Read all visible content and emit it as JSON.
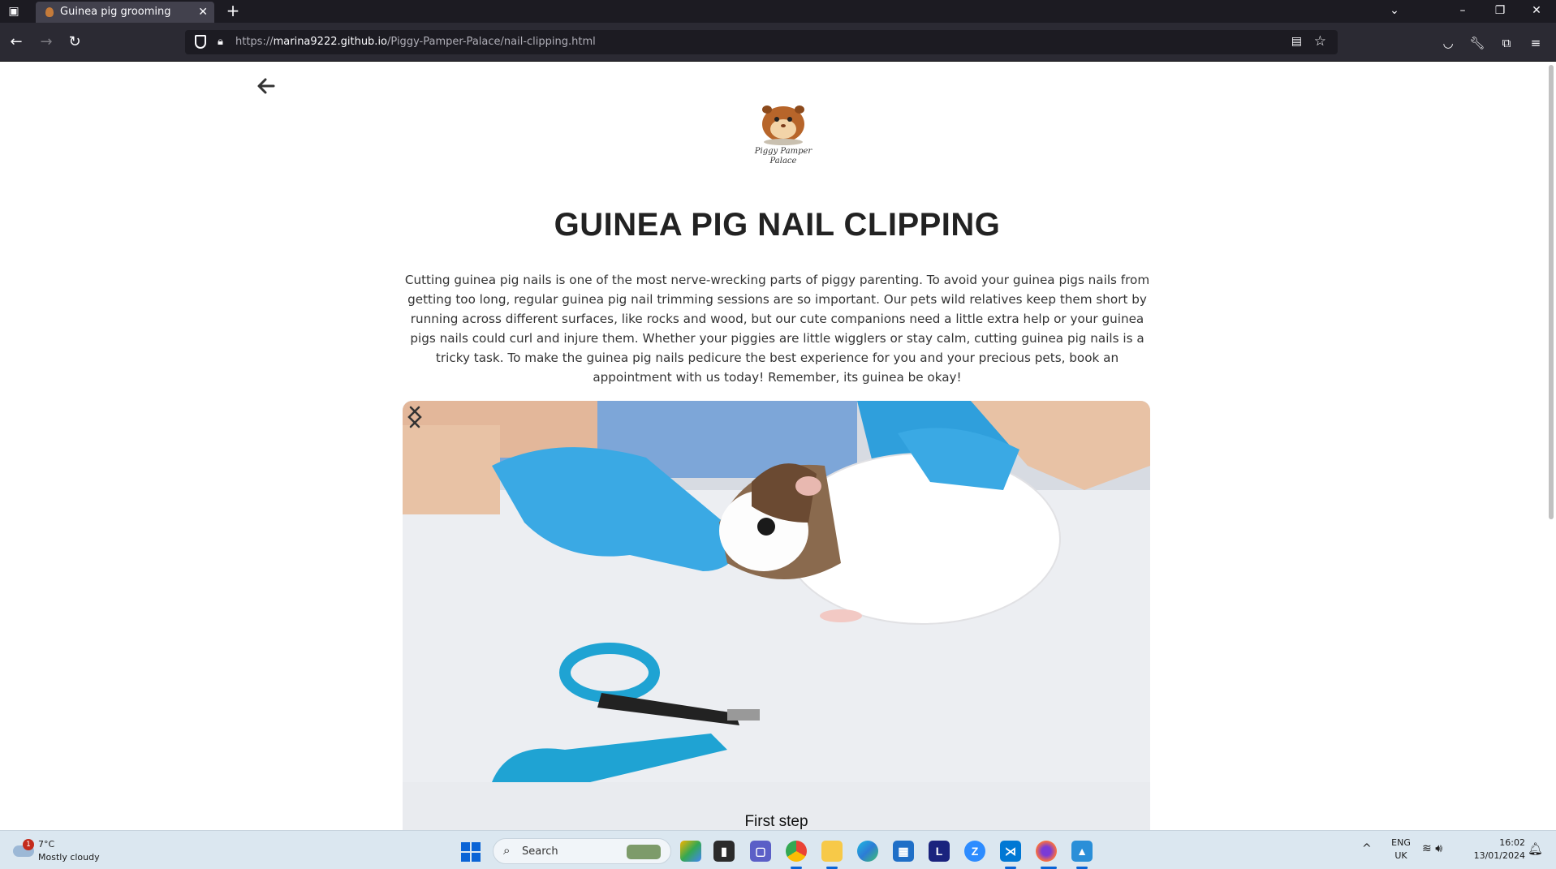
{
  "browser": {
    "tab_title": "Guinea pig grooming",
    "tab_close": "✕",
    "new_tab": "+",
    "url_prefix": "https://",
    "url_host": "marina9222.github.io",
    "url_path": "/Piggy-Pamper-Palace/nail-clipping.html"
  },
  "page": {
    "logo_text": "Piggy Pamper Palace",
    "title": "GUINEA PIG NAIL CLIPPING",
    "intro": "Cutting guinea pig nails is one of the most nerve-wrecking parts of piggy parenting. To avoid your guinea pigs nails from getting too long, regular guinea pig nail trimming sessions are so important. Our pets wild relatives keep them short by running across different surfaces, like rocks and wood, but our cute companions need a little extra help or your guinea pigs nails could curl and injure them. Whether your piggies are little wigglers or stay calm, cutting guinea pig nails is a tricky task. To make the guinea pig nails pedicure the best experience for you and your precious pets, book an appointment with us today! Remember, its guinea be okay!",
    "carousel": {
      "caption": "First step"
    }
  },
  "taskbar": {
    "weather_badge": "1",
    "weather_temp": "7°C",
    "weather_condition": "Mostly cloudy",
    "search_placeholder": "Search",
    "lang_line1": "ENG",
    "lang_line2": "UK",
    "time": "16:02",
    "date": "13/01/2024",
    "apps": [
      "copilot-icon",
      "terminal-icon",
      "teams-icon",
      "chrome-icon",
      "file-explorer-icon",
      "edge-icon",
      "store-icon",
      "l-app-icon",
      "zoom-icon",
      "vscode-icon",
      "firefox-icon",
      "photos-icon"
    ]
  }
}
